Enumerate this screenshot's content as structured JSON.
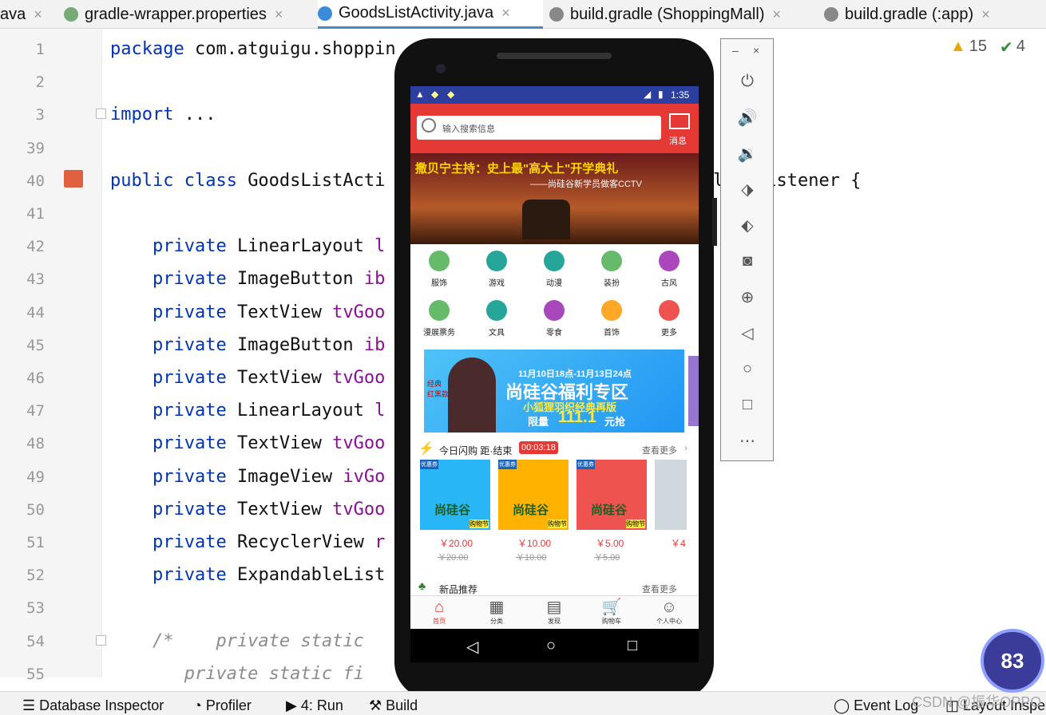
{
  "tabs": [
    {
      "label": "ava",
      "active": false
    },
    {
      "label": "gradle-wrapper.properties",
      "active": false
    },
    {
      "label": "GoodsListActivity.java",
      "active": true
    },
    {
      "label": "build.gradle (ShoppingMall)",
      "active": false
    },
    {
      "label": "build.gradle (:app)",
      "active": false
    }
  ],
  "editor": {
    "lines": [
      {
        "n": "1",
        "tokens": [
          {
            "t": "package ",
            "c": "kw"
          },
          {
            "t": "com.atguigu.shoppin",
            "c": ""
          }
        ]
      },
      {
        "n": "2",
        "tokens": []
      },
      {
        "n": "3",
        "tokens": [
          {
            "t": "import ",
            "c": "kw"
          },
          {
            "t": "...",
            "c": ""
          }
        ]
      },
      {
        "n": "39",
        "tokens": []
      },
      {
        "n": "40",
        "tokens": [
          {
            "t": "public class ",
            "c": "kw"
          },
          {
            "t": "GoodsListActi",
            "c": ""
          },
          {
            "t": "                  ",
            "c": ""
          },
          {
            "t": "e",
            "c": "kw"
          },
          {
            "t": "    View.OnClickListener {",
            "c": ""
          }
        ]
      },
      {
        "n": "41",
        "tokens": []
      },
      {
        "n": "42",
        "tokens": [
          {
            "t": "    private ",
            "c": "kw"
          },
          {
            "t": "LinearLayout ",
            "c": ""
          },
          {
            "t": "l",
            "c": "fld"
          }
        ]
      },
      {
        "n": "43",
        "tokens": [
          {
            "t": "    private ",
            "c": "kw"
          },
          {
            "t": "ImageButton ",
            "c": ""
          },
          {
            "t": "ib",
            "c": "fld"
          }
        ]
      },
      {
        "n": "44",
        "tokens": [
          {
            "t": "    private ",
            "c": "kw"
          },
          {
            "t": "TextView ",
            "c": ""
          },
          {
            "t": "tvGoo",
            "c": "fld"
          }
        ]
      },
      {
        "n": "45",
        "tokens": [
          {
            "t": "    private ",
            "c": "kw"
          },
          {
            "t": "ImageButton ",
            "c": ""
          },
          {
            "t": "ib",
            "c": "fld"
          }
        ]
      },
      {
        "n": "46",
        "tokens": [
          {
            "t": "    private ",
            "c": "kw"
          },
          {
            "t": "TextView ",
            "c": ""
          },
          {
            "t": "tvGoo",
            "c": "fld"
          }
        ]
      },
      {
        "n": "47",
        "tokens": [
          {
            "t": "    private ",
            "c": "kw"
          },
          {
            "t": "LinearLayout ",
            "c": ""
          },
          {
            "t": "l",
            "c": "fld"
          }
        ]
      },
      {
        "n": "48",
        "tokens": [
          {
            "t": "    private ",
            "c": "kw"
          },
          {
            "t": "TextView ",
            "c": ""
          },
          {
            "t": "tvGoo",
            "c": "fld"
          }
        ]
      },
      {
        "n": "49",
        "tokens": [
          {
            "t": "    private ",
            "c": "kw"
          },
          {
            "t": "ImageView ",
            "c": ""
          },
          {
            "t": "ivGo",
            "c": "fld"
          }
        ]
      },
      {
        "n": "50",
        "tokens": [
          {
            "t": "    private ",
            "c": "kw"
          },
          {
            "t": "TextView ",
            "c": ""
          },
          {
            "t": "tvGoo",
            "c": "fld"
          }
        ]
      },
      {
        "n": "51",
        "tokens": [
          {
            "t": "    private ",
            "c": "kw"
          },
          {
            "t": "RecyclerView ",
            "c": ""
          },
          {
            "t": "r",
            "c": "fld"
          }
        ]
      },
      {
        "n": "52",
        "tokens": [
          {
            "t": "    private ",
            "c": "kw"
          },
          {
            "t": "ExpandableList",
            "c": ""
          }
        ]
      },
      {
        "n": "53",
        "tokens": []
      },
      {
        "n": "54",
        "tokens": [
          {
            "t": "    /*    private static",
            "c": "cm"
          }
        ]
      },
      {
        "n": "55",
        "tokens": [
          {
            "t": "       private static fi",
            "c": "cm"
          }
        ]
      }
    ]
  },
  "inspections": {
    "warnings": "15",
    "weak_warnings": "4"
  },
  "statusbar": {
    "db": "Database Inspector",
    "profiler": "Profiler",
    "run": "4: Run",
    "build": "Build",
    "event": "Event Log",
    "layout": "Layout Inspe"
  },
  "watermark": "CSDN @振华OPPO",
  "badge": "83",
  "phone": {
    "time": "1:35",
    "search_placeholder": "输入搜索信息",
    "message_label": "消息",
    "banner_title": "撒贝宁主持：史上最\"高大上\"开学典礼",
    "banner_subtitle": "——尚硅谷新学员做客CCTV",
    "categories": [
      "服饰",
      "游戏",
      "动漫",
      "装扮",
      "古风",
      "漫展票务",
      "文具",
      "零食",
      "首饰",
      "更多"
    ],
    "promo": {
      "line1": "11月10日18点-11月13日24点",
      "line2": "尚硅谷福利专区",
      "line3": "小狐狸羽织经典再版",
      "line4": "限量",
      "price": "111.1",
      "unit": "元抢",
      "tag": "经典\n红黑款"
    },
    "flash": {
      "title": "今日闪购 距·结束",
      "timer": "00:03:18",
      "more": "查看更多"
    },
    "products": [
      {
        "price": "￥20.00",
        "old": "￥20.00"
      },
      {
        "price": "￥10.00",
        "old": "￥10.00"
      },
      {
        "price": "￥5.00",
        "old": "￥5.00"
      },
      {
        "price": "￥4",
        "old": ""
      }
    ],
    "product_brand": "尚硅谷",
    "product_corner": "购物节",
    "product_flag": "优惠券",
    "new_section": {
      "title": "新品推荐",
      "more": "查看更多"
    },
    "bottom_nav": [
      "首页",
      "分类",
      "发现",
      "购物车",
      "个人中心"
    ]
  },
  "colors": {
    "accent_red": "#e53935",
    "keyword_blue": "#0033b3",
    "field_purple": "#871094"
  }
}
